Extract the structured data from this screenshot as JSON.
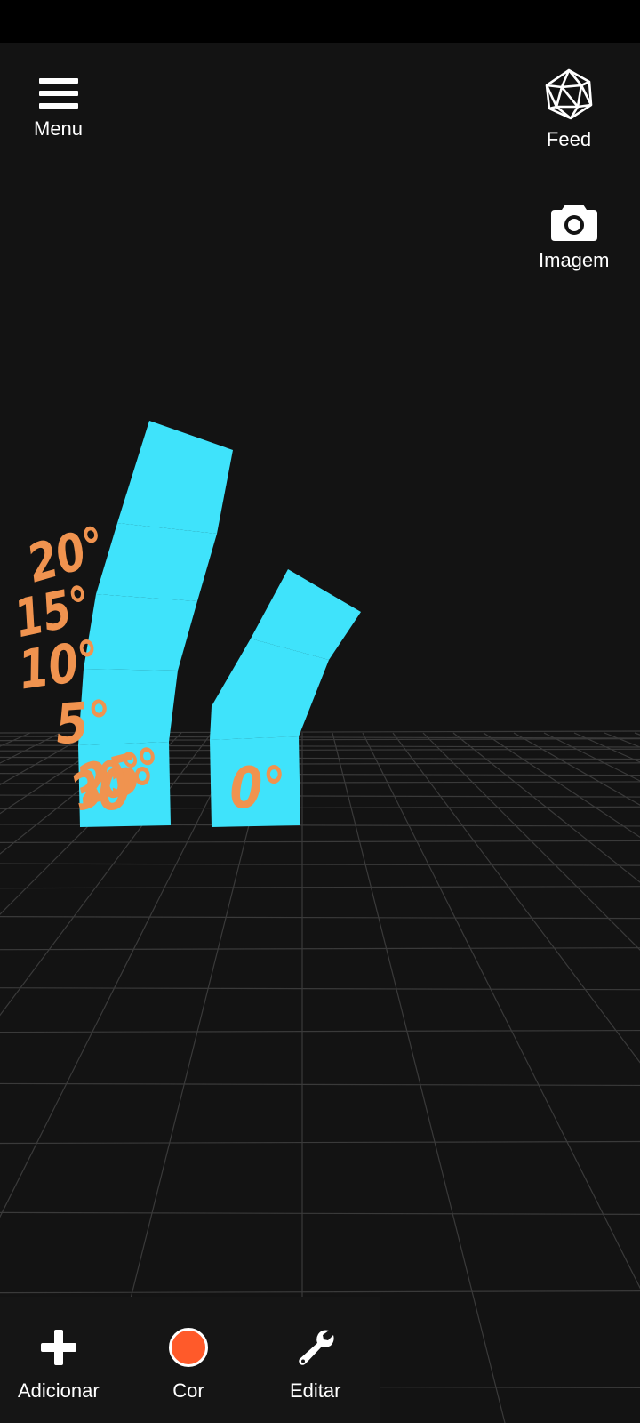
{
  "header": {
    "menu": {
      "label": "Menu",
      "icon": "menu-icon"
    },
    "feed": {
      "label": "Feed",
      "icon": "icosahedron-icon"
    },
    "image": {
      "label": "Imagem",
      "icon": "camera-icon"
    }
  },
  "scene": {
    "column_left": {
      "segments": [
        "0°",
        "5°",
        "10°",
        "15°",
        "20°"
      ]
    },
    "column_right": {
      "segments": [
        "0°",
        "25°",
        "30°"
      ]
    },
    "colors": {
      "segment_fill": "#3fe3fb",
      "label_color": "#f0934f",
      "grid_line": "#3a3a3a"
    }
  },
  "toolbar": {
    "add": {
      "label": "Adicionar",
      "icon": "plus-icon"
    },
    "color": {
      "label": "Cor",
      "icon": "color-dot-icon",
      "value": "#ff5a2a"
    },
    "edit": {
      "label": "Editar",
      "icon": "wrench-icon"
    }
  }
}
